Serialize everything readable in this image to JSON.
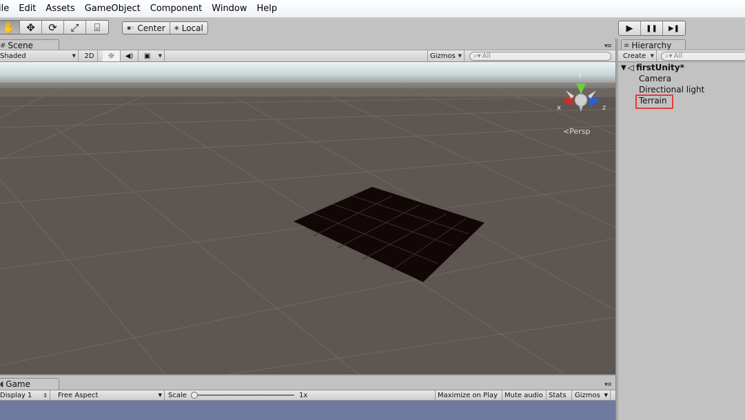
{
  "menu": [
    "ile",
    "Edit",
    "Assets",
    "GameObject",
    "Component",
    "Window",
    "Help"
  ],
  "toolbar": {
    "tools": [
      {
        "icon": "hand-icon",
        "glyph": "✋"
      },
      {
        "icon": "move-icon",
        "glyph": "✥"
      },
      {
        "icon": "rotate-icon",
        "glyph": "⟳"
      },
      {
        "icon": "scale-icon",
        "glyph": "⤢"
      },
      {
        "icon": "rect-icon",
        "glyph": "⌻"
      }
    ],
    "pivot_label": "Center",
    "space_label": "Local",
    "play": "▶",
    "pause": "❚❚",
    "step": "▶❚"
  },
  "scene": {
    "tab_label": "Scene",
    "shading": "Shaded",
    "mode_2d": "2D",
    "lighting_glyph": "☼",
    "audio_glyph": "◀)",
    "effects_glyph": "▣",
    "gizmos": "Gizmos",
    "search_placeholder": "All",
    "persp_label": "Persp",
    "axis_x": "x",
    "axis_y": "y",
    "axis_z": "z"
  },
  "game": {
    "tab_label": "Game",
    "display": "Display 1",
    "aspect": "Free Aspect",
    "scale_label": "Scale",
    "scale_value": "1x",
    "scale_fraction": 0.0,
    "maximize": "Maximize on Play",
    "mute": "Mute audio",
    "stats": "Stats",
    "gizmos": "Gizmos"
  },
  "hierarchy": {
    "tab_label": "Hierarchy",
    "create_label": "Create",
    "search_placeholder": "All",
    "scene_name": "firstUnity*",
    "items": [
      "Camera",
      "Directional light",
      "Terrain"
    ],
    "highlight_color": "#e23b3b"
  },
  "colors": {
    "viewport_bg": "#5e5651",
    "terrain": "#120707",
    "game_bg": "#6e7b9e"
  }
}
